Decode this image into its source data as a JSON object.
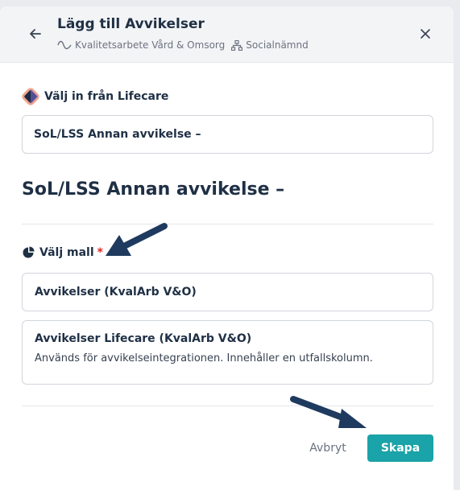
{
  "header": {
    "title": "Lägg till Avvikelser",
    "breadcrumb_1": "Kvalitetsarbete Vård & Omsorg",
    "breadcrumb_2": "Socialnämnd"
  },
  "lifecare": {
    "label": "Välj in från Lifecare",
    "input_value": "SoL/LSS Annan avvikelse –"
  },
  "preview_title": "SoL/LSS Annan avvikelse –",
  "template_picker": {
    "label": "Välj mall",
    "required_mark": "*",
    "options": [
      {
        "title": "Avvikelser (KvalArb V&O)",
        "description": ""
      },
      {
        "title": "Avvikelser Lifecare (KvalArb V&O)",
        "description": "Används för avvikelseintegrationen. Innehåller en utfallskolumn."
      }
    ]
  },
  "footer": {
    "cancel_label": "Avbryt",
    "create_label": "Skapa"
  },
  "colors": {
    "accent": "#1aa3a8",
    "heading": "#1f3045",
    "annotation_arrow": "#1f3a5f",
    "required": "#dc2626"
  },
  "icons": [
    "back-arrow-icon",
    "activity-wave-icon",
    "org-chart-icon",
    "close-icon",
    "lifecare-logo-icon",
    "pie-chart-icon",
    "annotation-arrow"
  ]
}
